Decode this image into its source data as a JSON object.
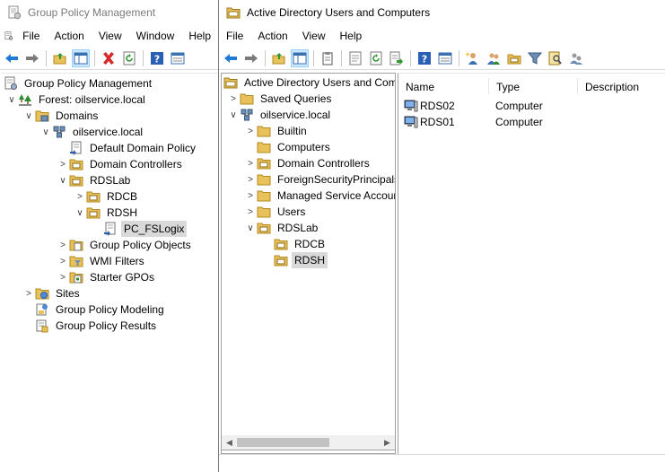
{
  "gpm": {
    "title": "Group Policy Management",
    "menu": [
      "File",
      "Action",
      "View",
      "Window",
      "Help"
    ],
    "tree": {
      "root": "Group Policy Management",
      "forest": "Forest: oilservice.local",
      "domains": "Domains",
      "domain": "oilservice.local",
      "default_policy": "Default Domain Policy",
      "domain_controllers": "Domain Controllers",
      "rdslab": "RDSLab",
      "rdcb": "RDCB",
      "rdsh": "RDSH",
      "gpo_link": "PC_FSLogix",
      "gpo_objects": "Group Policy Objects",
      "wmi_filters": "WMI Filters",
      "starter_gpos": "Starter GPOs",
      "sites": "Sites",
      "modeling": "Group Policy Modeling",
      "results": "Group Policy Results"
    }
  },
  "aduc": {
    "title": "Active Directory Users and Computers",
    "menu": [
      "File",
      "Action",
      "View",
      "Help"
    ],
    "tree": {
      "root": "Active Directory Users and Com",
      "saved_queries": "Saved Queries",
      "domain": "oilservice.local",
      "builtin": "Builtin",
      "computers": "Computers",
      "domain_controllers": "Domain Controllers",
      "fsp": "ForeignSecurityPrincipals",
      "msa": "Managed Service Accour",
      "users": "Users",
      "rdslab": "RDSLab",
      "rdcb": "RDCB",
      "rdsh": "RDSH"
    },
    "columns": {
      "name": "Name",
      "type": "Type",
      "description": "Description"
    },
    "rows": [
      {
        "name": "RDS02",
        "type": "Computer"
      },
      {
        "name": "RDS01",
        "type": "Computer"
      }
    ]
  }
}
